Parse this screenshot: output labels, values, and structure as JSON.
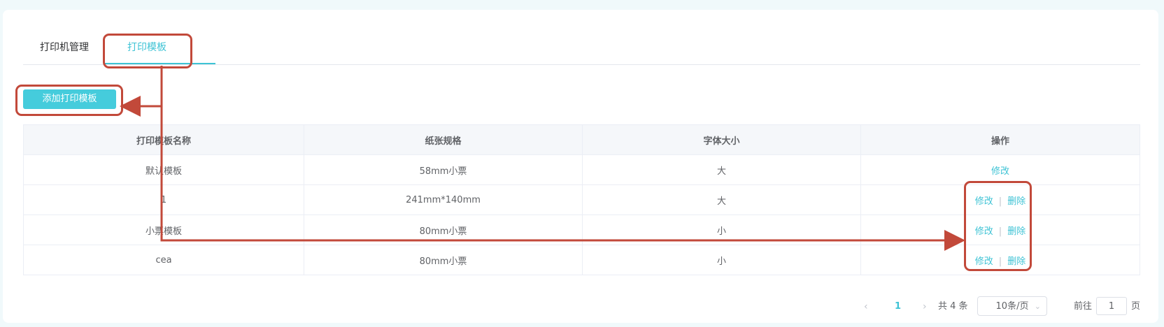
{
  "tabs": [
    {
      "label": "打印机管理"
    },
    {
      "label": "打印模板"
    }
  ],
  "add_button": "添加打印模板",
  "table": {
    "headers": [
      "打印模板名称",
      "纸张规格",
      "字体大小",
      "操作"
    ],
    "rows": [
      {
        "name": "默认模板",
        "paper": "58mm小票",
        "font": "大"
      },
      {
        "name": "1",
        "paper": "241mm*140mm",
        "font": "大"
      },
      {
        "name": "小票模板",
        "paper": "80mm小票",
        "font": "小"
      },
      {
        "name": "cea",
        "paper": "80mm小票",
        "font": "小"
      }
    ],
    "edit_label": "修改",
    "delete_label": "删除"
  },
  "pagination": {
    "prev": "‹",
    "current": "1",
    "next": "›",
    "total": "共 4 条",
    "page_size": "10条/页",
    "goto_prefix": "前往",
    "goto_value": "1",
    "goto_suffix": "页"
  },
  "colors": {
    "accent": "#3ec3d5",
    "annotation": "#c2493a"
  }
}
